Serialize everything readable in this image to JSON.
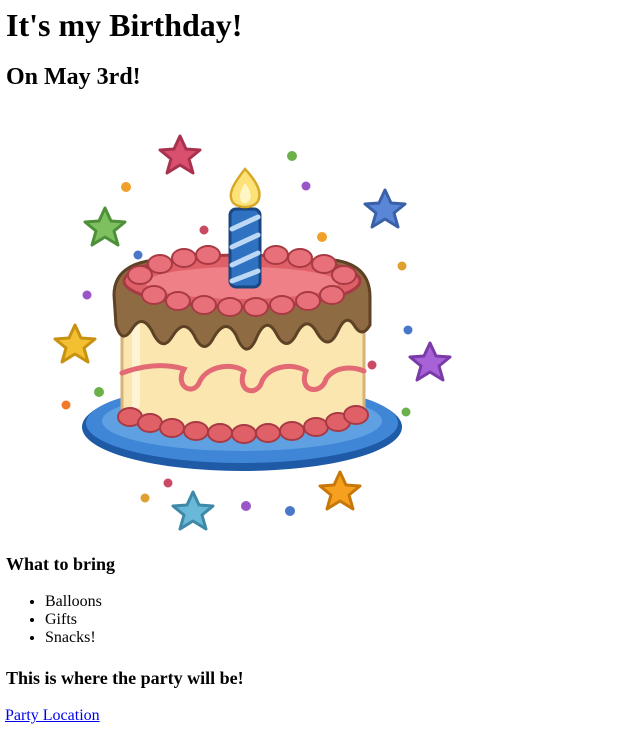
{
  "heading": "It's my Birthday!",
  "subheading": "On May 3rd!",
  "image": {
    "icon": "birthday-cake-icon",
    "colors": {
      "plate": "#2f72c2",
      "frosting": "#e06068",
      "chocolate": "#8f6b43",
      "sponge": "#fbe6b0",
      "candle": "#2f72c2",
      "flame": "#fde27a"
    }
  },
  "bring": {
    "title": "What to bring",
    "items": [
      "Balloons",
      "Gifts",
      "Snacks!"
    ]
  },
  "party": {
    "title": "This is where the party will be!",
    "link_label": "Party Location"
  }
}
